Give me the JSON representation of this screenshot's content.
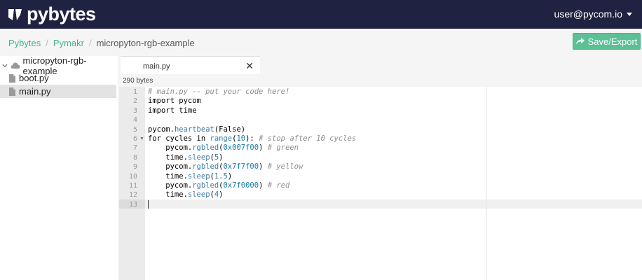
{
  "header": {
    "logo_text": "pybytes",
    "user_label": "user@pycom.io"
  },
  "breadcrumb": {
    "items": [
      "Pybytes",
      "Pymakr"
    ],
    "current": "micropyton-rgb-example",
    "separator": "/"
  },
  "toolbar": {
    "save_label": "Save/Export"
  },
  "sidebar": {
    "root_label": "micropyton-rgb-example",
    "files": [
      {
        "label": "boot.py",
        "selected": false
      },
      {
        "label": "main.py",
        "selected": true
      }
    ]
  },
  "editor": {
    "tab_label": "main.py",
    "close_glyph": "✕",
    "file_size": "290 bytes",
    "active_line": 13,
    "fold_marker_line": 6,
    "line_numbers": [
      "1",
      "2",
      "3",
      "4",
      "5",
      "6",
      "7",
      "8",
      "9",
      "10",
      "11",
      "12",
      "13"
    ],
    "lines": [
      [
        {
          "t": "# main.py -- put your code here!",
          "c": "comment"
        }
      ],
      [
        {
          "t": "import pycom",
          "c": "keyword"
        }
      ],
      [
        {
          "t": "import time",
          "c": "keyword"
        }
      ],
      [],
      [
        {
          "t": "pycom.",
          "c": "plain"
        },
        {
          "t": "heartbeat",
          "c": "call"
        },
        {
          "t": "(False)",
          "c": "plain"
        }
      ],
      [
        {
          "t": "for cycles in ",
          "c": "keyword"
        },
        {
          "t": "range",
          "c": "call"
        },
        {
          "t": "(",
          "c": "plain"
        },
        {
          "t": "10",
          "c": "num"
        },
        {
          "t": "): ",
          "c": "plain"
        },
        {
          "t": "# stop after 10 cycles",
          "c": "comment"
        }
      ],
      [
        {
          "t": "    pycom.",
          "c": "plain"
        },
        {
          "t": "rgbled",
          "c": "call"
        },
        {
          "t": "(",
          "c": "plain"
        },
        {
          "t": "0x007f00",
          "c": "num"
        },
        {
          "t": ") ",
          "c": "plain"
        },
        {
          "t": "# green",
          "c": "comment"
        }
      ],
      [
        {
          "t": "    time.",
          "c": "plain"
        },
        {
          "t": "sleep",
          "c": "call"
        },
        {
          "t": "(",
          "c": "plain"
        },
        {
          "t": "5",
          "c": "num"
        },
        {
          "t": ")",
          "c": "plain"
        }
      ],
      [
        {
          "t": "    pycom.",
          "c": "plain"
        },
        {
          "t": "rgbled",
          "c": "call"
        },
        {
          "t": "(",
          "c": "plain"
        },
        {
          "t": "0x7f7f00",
          "c": "num"
        },
        {
          "t": ") ",
          "c": "plain"
        },
        {
          "t": "# yellow",
          "c": "comment"
        }
      ],
      [
        {
          "t": "    time.",
          "c": "plain"
        },
        {
          "t": "sleep",
          "c": "call"
        },
        {
          "t": "(",
          "c": "plain"
        },
        {
          "t": "1.5",
          "c": "num"
        },
        {
          "t": ")",
          "c": "plain"
        }
      ],
      [
        {
          "t": "    pycom.",
          "c": "plain"
        },
        {
          "t": "rgbled",
          "c": "call"
        },
        {
          "t": "(",
          "c": "plain"
        },
        {
          "t": "0x7f0000",
          "c": "num"
        },
        {
          "t": ") ",
          "c": "plain"
        },
        {
          "t": "# red",
          "c": "comment"
        }
      ],
      [
        {
          "t": "    time.",
          "c": "plain"
        },
        {
          "t": "sleep",
          "c": "call"
        },
        {
          "t": "(",
          "c": "plain"
        },
        {
          "t": "4",
          "c": "num"
        },
        {
          "t": ")",
          "c": "plain"
        }
      ],
      []
    ]
  },
  "icons": {
    "logo": "pybytes-logo-icon",
    "caret": "caret-down-icon",
    "save": "share-arrow-icon",
    "folder": "cloud-icon",
    "file": "file-icon",
    "chevron": "chevron-down-icon"
  },
  "colors": {
    "header_bg": "#1f2240",
    "accent_green": "#5cc097",
    "link_green": "#3fb58c",
    "comment": "#8d8d8d",
    "call": "#3c7aa6"
  }
}
